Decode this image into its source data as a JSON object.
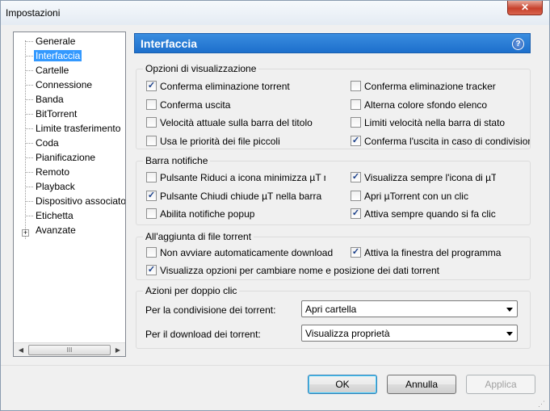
{
  "window": {
    "title": "Impostazioni",
    "close_label": "✕"
  },
  "tree": {
    "items": [
      {
        "label": "Generale",
        "selected": false
      },
      {
        "label": "Interfaccia",
        "selected": true
      },
      {
        "label": "Cartelle",
        "selected": false
      },
      {
        "label": "Connessione",
        "selected": false
      },
      {
        "label": "Banda",
        "selected": false
      },
      {
        "label": "BitTorrent",
        "selected": false
      },
      {
        "label": "Limite trasferimento",
        "selected": false
      },
      {
        "label": "Coda",
        "selected": false
      },
      {
        "label": "Pianificazione",
        "selected": false
      },
      {
        "label": "Remoto",
        "selected": false
      },
      {
        "label": "Playback",
        "selected": false
      },
      {
        "label": "Dispositivo associato",
        "selected": false
      },
      {
        "label": "Etichetta",
        "selected": false
      },
      {
        "label": "Avanzate",
        "selected": false
      }
    ],
    "expander": "+",
    "scroll_left": "◀",
    "scroll_right": "▶",
    "thumb_grip": "III"
  },
  "header": {
    "title": "Interfaccia",
    "help": "?"
  },
  "display_options": {
    "title": "Opzioni di visualizzazione",
    "left": [
      {
        "label": "Conferma eliminazione torrent",
        "checked": true
      },
      {
        "label": "Conferma uscita",
        "checked": false
      },
      {
        "label": "Velocità attuale sulla barra del titolo",
        "checked": false
      },
      {
        "label": "Usa le priorità dei file piccoli",
        "checked": false
      }
    ],
    "right": [
      {
        "label": "Conferma eliminazione tracker",
        "checked": false
      },
      {
        "label": "Alterna colore sfondo elenco",
        "checked": false
      },
      {
        "label": "Limiti velocità nella barra di stato",
        "checked": false
      },
      {
        "label": "Conferma l'uscita in caso di condivisione",
        "checked": true
      }
    ]
  },
  "tray": {
    "title": "Barra notifiche",
    "left": [
      {
        "label": "Pulsante Riduci a icona minimizza µT nella barra",
        "checked": false
      },
      {
        "label": "Pulsante Chiudi chiude µT nella barra",
        "checked": true
      },
      {
        "label": "Abilita notifiche popup",
        "checked": false
      }
    ],
    "right": [
      {
        "label": "Visualizza sempre l'icona di µTorrent",
        "checked": true
      },
      {
        "label": "Apri µTorrent con un clic",
        "checked": false
      },
      {
        "label": "Attiva sempre quando si fa clic",
        "checked": true
      }
    ]
  },
  "adding": {
    "title": "All'aggiunta di file torrent",
    "row1_left": {
      "label": "Non avviare automaticamente download",
      "checked": false
    },
    "row1_right": {
      "label": "Attiva la finestra del programma",
      "checked": true
    },
    "row2": {
      "label": "Visualizza opzioni per cambiare nome e posizione dei dati torrent",
      "checked": true
    }
  },
  "double_click": {
    "title": "Azioni per doppio clic",
    "seeding_label": "Per la condivisione dei torrent:",
    "seeding_value": "Apri cartella",
    "downloading_label": "Per il download dei torrent:",
    "downloading_value": "Visualizza proprietà"
  },
  "buttons": {
    "ok": "OK",
    "cancel": "Annulla",
    "apply": "Applica"
  },
  "check_glyph": "✓"
}
